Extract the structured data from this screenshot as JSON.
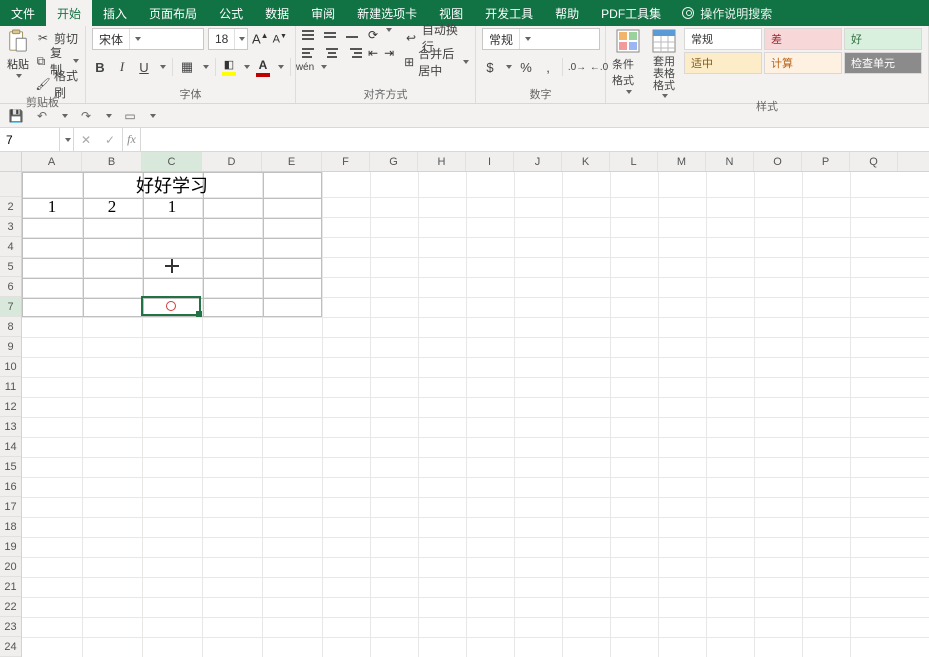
{
  "tabs": {
    "file": "文件",
    "home": "开始",
    "insert": "插入",
    "page_layout": "页面布局",
    "formulas": "公式",
    "data": "数据",
    "review": "审阅",
    "new_tab": "新建选项卡",
    "view": "视图",
    "developer": "开发工具",
    "help": "帮助",
    "pdf": "PDF工具集",
    "tell_me": "操作说明搜索"
  },
  "clipboard": {
    "paste": "粘贴",
    "cut": "剪切",
    "copy": "复制",
    "format_painter": "格式刷",
    "group_label": "剪贴板"
  },
  "font": {
    "name": "宋体",
    "size": "18",
    "group_label": "字体"
  },
  "alignment": {
    "wrap": "自动换行",
    "merge": "合并后居中",
    "group_label": "对齐方式"
  },
  "number": {
    "format": "常规",
    "group_label": "数字"
  },
  "styles": {
    "cond_fmt": "条件格式",
    "table_fmt": "套用\n表格格式",
    "normal": "常规",
    "bad": "差",
    "good": "好",
    "neutral": "适中",
    "calc": "计算",
    "check": "检查单元",
    "group_label": "样式"
  },
  "formula_bar": {
    "namebox": "7",
    "fx_label": "fx",
    "value": ""
  },
  "grid": {
    "columns": [
      "A",
      "B",
      "C",
      "D",
      "E",
      "F",
      "G",
      "H",
      "I",
      "J",
      "K",
      "L",
      "M",
      "N",
      "O",
      "P",
      "Q"
    ],
    "col_width_first5": 60,
    "col_width_rest": 48,
    "row_height_1": 25,
    "row_height_rest": 20,
    "visible_rows": 24,
    "selected_col_index": 2,
    "selected_row_index": 6,
    "cells": {
      "C1": "好好学习",
      "A2": "1",
      "B2": "2",
      "C2": "1"
    }
  }
}
